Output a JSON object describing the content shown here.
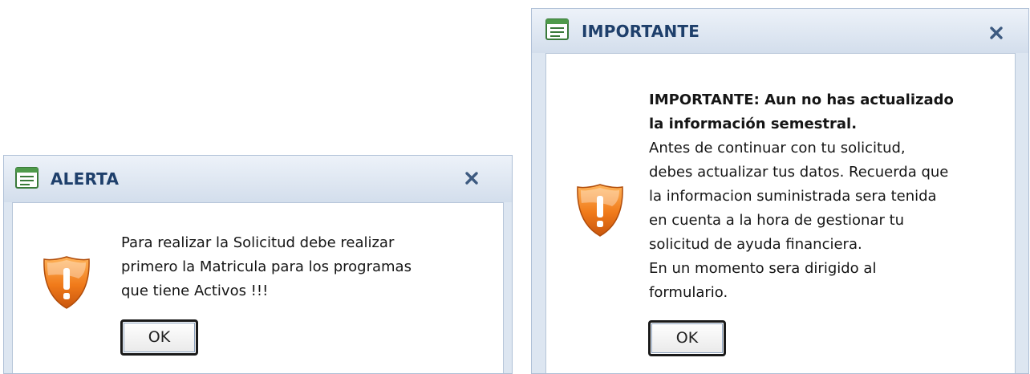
{
  "colors": {
    "title_text": "#1e3f6b",
    "frame_background": "#dde6f1",
    "content_background": "#ffffff",
    "shield_orange": "#f07a1a",
    "close_icon": "#3d5a80"
  },
  "dialogs": {
    "alert": {
      "title": "ALERTA",
      "title_icon": "window-icon",
      "close_icon": "close-icon",
      "status_icon": "warning-shield-icon",
      "message_lines": [
        "Para realizar la Solicitud debe realizar",
        "primero la Matricula para los programas",
        "que tiene Activos !!!"
      ],
      "ok_label": "OK"
    },
    "important": {
      "title": "IMPORTANTE",
      "title_icon": "window-icon",
      "close_icon": "close-icon",
      "status_icon": "warning-shield-icon",
      "heading_lines": [
        "IMPORTANTE: Aun no has actualizado",
        "la información semestral."
      ],
      "message_lines": [
        "Antes de continuar con tu solicitud,",
        "debes actualizar tus datos. Recuerda que",
        "la informacion suministrada sera tenida",
        "en cuenta a la hora de gestionar tu",
        "solicitud de ayuda financiera.",
        "En un momento sera dirigido al",
        "formulario."
      ],
      "ok_label": "OK"
    }
  }
}
